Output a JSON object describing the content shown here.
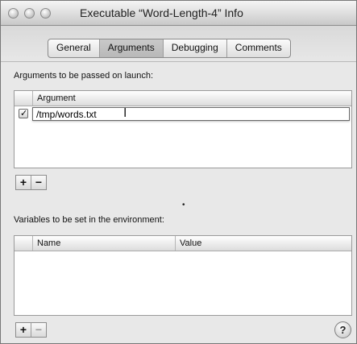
{
  "window": {
    "title": "Executable “Word-Length-4” Info"
  },
  "tabs": [
    {
      "label": "General"
    },
    {
      "label": "Arguments"
    },
    {
      "label": "Debugging"
    },
    {
      "label": "Comments"
    }
  ],
  "active_tab": "Arguments",
  "arguments_section": {
    "label": "Arguments to be passed on launch:",
    "column_header": "Argument",
    "rows": [
      {
        "checked": true,
        "value": "/tmp/words.txt"
      }
    ]
  },
  "env_section": {
    "label": "Variables to be set in the environment:",
    "columns": [
      "Name",
      "Value"
    ],
    "rows": []
  },
  "buttons": {
    "add": "+",
    "remove": "−",
    "help": "?"
  },
  "icons": {
    "checkmark": "✓",
    "text_cursor": "I",
    "mouse_cursor": "•"
  }
}
